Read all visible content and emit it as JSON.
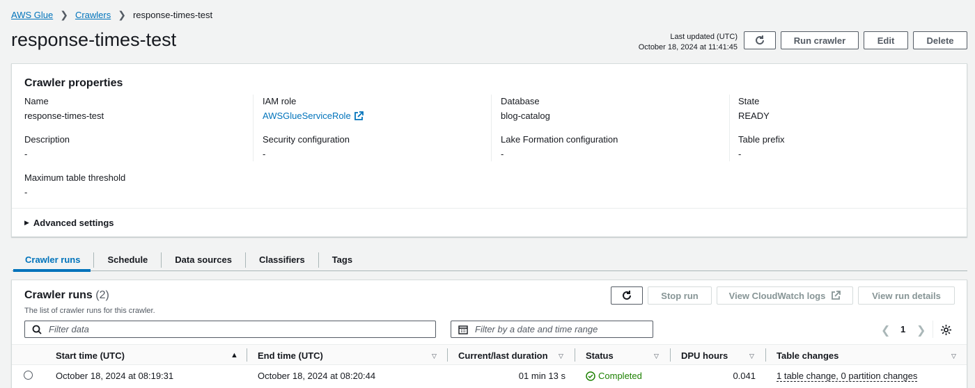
{
  "breadcrumb": {
    "items": [
      "AWS Glue",
      "Crawlers"
    ],
    "current": "response-times-test"
  },
  "page": {
    "title": "response-times-test",
    "last_updated_label": "Last updated (UTC)",
    "last_updated_value": "October 18, 2024 at 11:41:45",
    "buttons": {
      "run": "Run crawler",
      "edit": "Edit",
      "delete": "Delete"
    }
  },
  "properties": {
    "title": "Crawler properties",
    "name_label": "Name",
    "name_value": "response-times-test",
    "iam_label": "IAM role",
    "iam_value": "AWSGlueServiceRole",
    "db_label": "Database",
    "db_value": "blog-catalog",
    "state_label": "State",
    "state_value": "READY",
    "desc_label": "Description",
    "desc_value": "-",
    "sec_label": "Security configuration",
    "sec_value": "-",
    "lake_label": "Lake Formation configuration",
    "lake_value": "-",
    "prefix_label": "Table prefix",
    "prefix_value": "-",
    "max_label": "Maximum table threshold",
    "max_value": "-",
    "advanced": "Advanced settings"
  },
  "tabs": [
    "Crawler runs",
    "Schedule",
    "Data sources",
    "Classifiers",
    "Tags"
  ],
  "runs": {
    "title": "Crawler runs",
    "count": "(2)",
    "description": "The list of crawler runs for this crawler.",
    "stop_button": "Stop run",
    "cloudwatch_button": "View CloudWatch logs",
    "details_button": "View run details",
    "filter_placeholder": "Filter data",
    "date_placeholder": "Filter by a date and time range",
    "page_number": "1",
    "columns": [
      "Start time (UTC)",
      "End time (UTC)",
      "Current/last duration",
      "Status",
      "DPU hours",
      "Table changes"
    ],
    "rows": [
      {
        "start": "October 18, 2024 at 08:19:31",
        "end": "October 18, 2024 at 08:20:44",
        "duration": "01 min 13 s",
        "status": "Completed",
        "dpu": "0.041",
        "changes": "1 table change, 0 partition changes"
      }
    ]
  },
  "colors": {
    "link": "#0073bb",
    "success": "#1d8102"
  }
}
